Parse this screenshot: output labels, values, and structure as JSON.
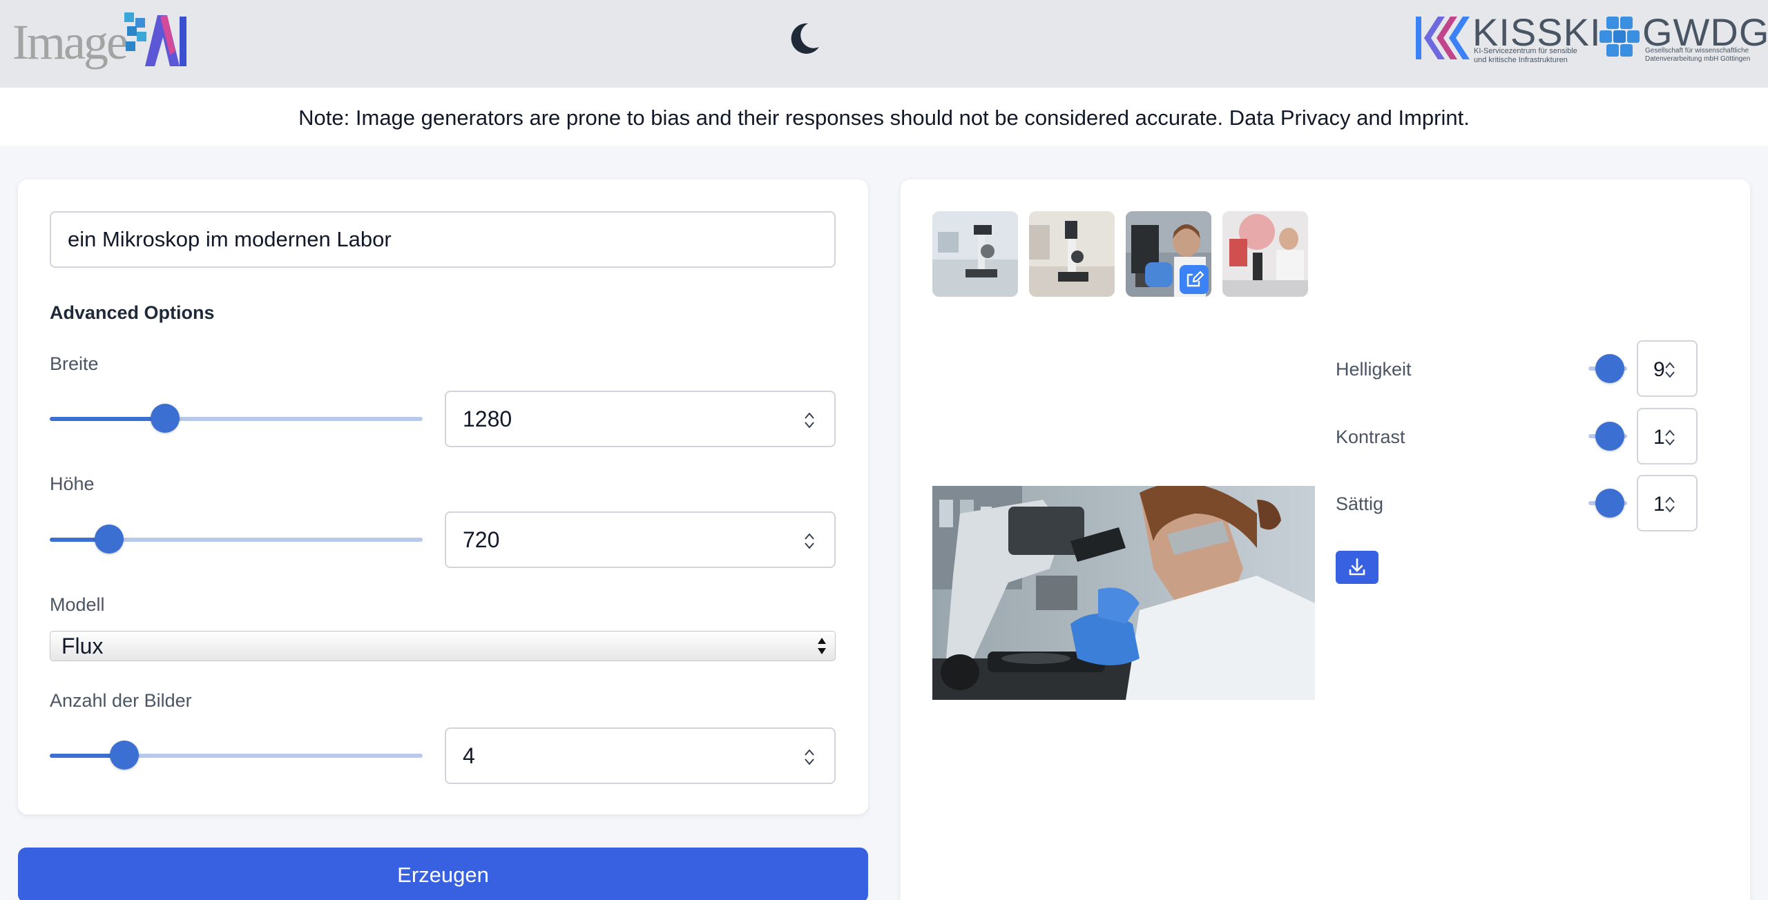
{
  "header": {
    "logo_text": "Image",
    "logo_ai": "AI",
    "theme_toggle_icon": "moon-icon",
    "partner1": {
      "name": "KISSKI",
      "subtitle": "KI-Servicezentrum für sensible und kritische Infrastrukturen"
    },
    "partner2": {
      "name": "GWDG",
      "subtitle": "Gesellschaft für wissenschaftliche Datenverarbeitung mbH Göttingen"
    }
  },
  "note": "Note: Image generators are prone to bias and their responses should not be considered accurate. Data Privacy and Imprint.",
  "form": {
    "prompt": "ein Mikroskop im modernen Labor",
    "advanced_title": "Advanced Options",
    "width": {
      "label": "Breite",
      "value": "1280",
      "fraction": 0.31
    },
    "height": {
      "label": "Höhe",
      "value": "720",
      "fraction": 0.16
    },
    "model": {
      "label": "Modell",
      "selected": "Flux"
    },
    "count": {
      "label": "Anzahl der Bilder",
      "value": "4",
      "fraction": 0.2
    },
    "generate_label": "Erzeugen"
  },
  "output": {
    "thumbnails": [
      "thumbnail-1",
      "thumbnail-2",
      "thumbnail-3",
      "thumbnail-4"
    ],
    "edit_icon": "edit-icon",
    "adjustments": [
      {
        "label": "Helligkeit",
        "value": "9"
      },
      {
        "label": "Kontrast",
        "value": "1"
      },
      {
        "label": "Sättig",
        "value": "1"
      }
    ],
    "download_icon": "download-icon"
  },
  "colors": {
    "accent": "#3761e0",
    "slider": "#3b6fd1",
    "track": "#b8c9ec"
  }
}
